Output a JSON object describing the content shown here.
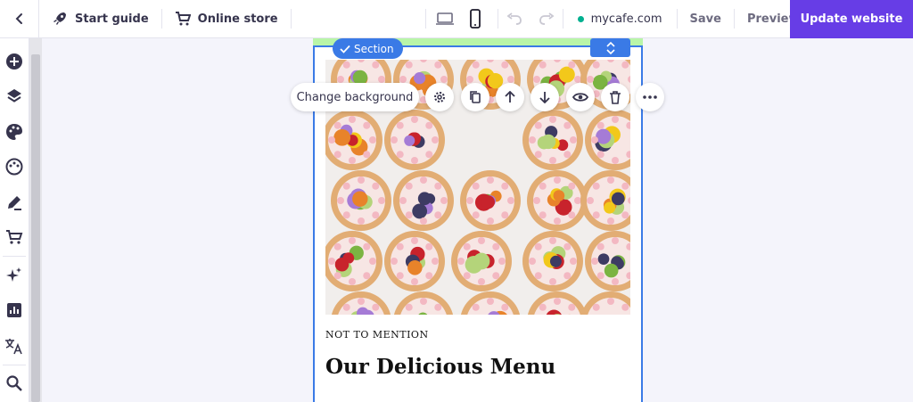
{
  "topbar": {
    "start_guide": "Start guide",
    "online_store": "Online store",
    "domain": "mycafe.com",
    "save": "Save",
    "preview": "Preview",
    "update": "Update website"
  },
  "editor": {
    "section_badge": "Section",
    "change_background": "Change background"
  },
  "content": {
    "eyebrow": "NOT TO MENTION",
    "heading": "Our Delicious Menu"
  },
  "left_tools": [
    "add-icon",
    "layers-icon",
    "palette-icon",
    "theme-icon",
    "edit-icon",
    "store-icon",
    "ai-sparkle-icon",
    "analytics-icon",
    "translate-icon",
    "search-icon"
  ],
  "colors": {
    "accent": "#673de6",
    "selection": "#3a7ae6",
    "domain_status": "#00b090",
    "section_strip": "#b9f5a8"
  }
}
